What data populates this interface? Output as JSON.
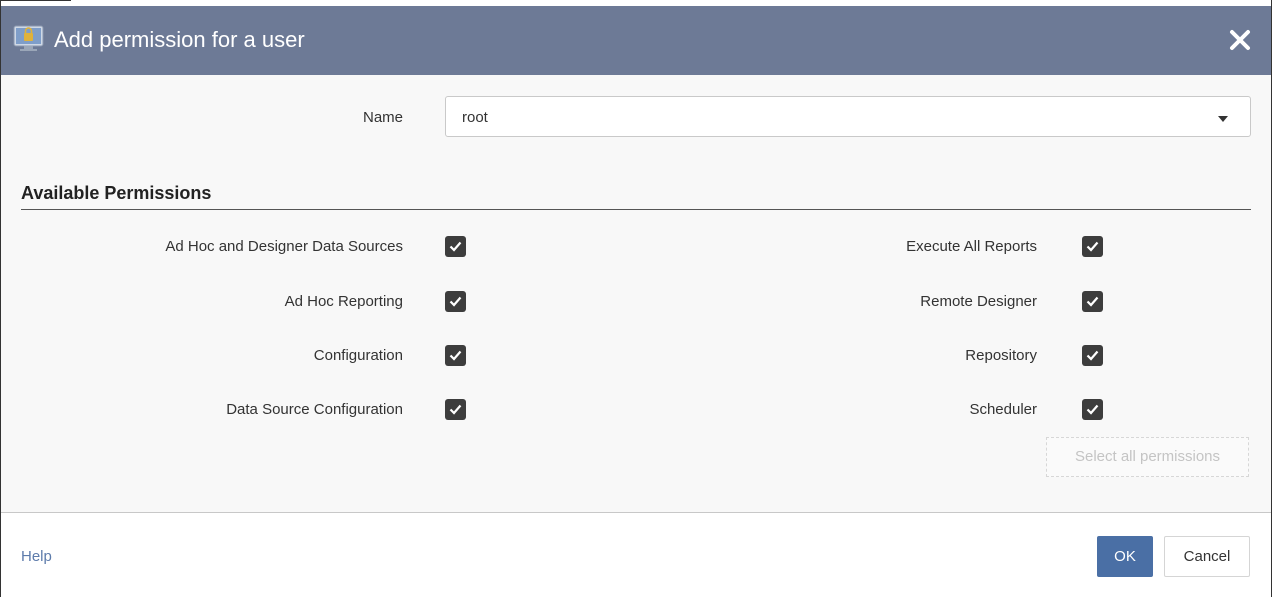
{
  "dialog": {
    "title": "Add permission for a user",
    "title_icon": "user-lock-icon",
    "close_icon": "close-icon"
  },
  "name_field": {
    "label": "Name",
    "value": "root"
  },
  "permissions": {
    "section_title": "Available Permissions",
    "left": [
      {
        "label": "Ad Hoc and Designer Data Sources",
        "checked": true
      },
      {
        "label": "Ad Hoc Reporting",
        "checked": true
      },
      {
        "label": "Configuration",
        "checked": true
      },
      {
        "label": "Data Source Configuration",
        "checked": true
      }
    ],
    "right": [
      {
        "label": "Execute All Reports",
        "checked": true
      },
      {
        "label": "Remote Designer",
        "checked": true
      },
      {
        "label": "Repository",
        "checked": true
      },
      {
        "label": "Scheduler",
        "checked": true
      }
    ],
    "select_all_label": "Select all permissions"
  },
  "footer": {
    "help_label": "Help",
    "ok_label": "OK",
    "cancel_label": "Cancel"
  },
  "colors": {
    "titlebar": "#6d7a96",
    "primary_button": "#4a6fa5",
    "checkbox": "#3d3d3d",
    "link": "#5d7bab"
  }
}
